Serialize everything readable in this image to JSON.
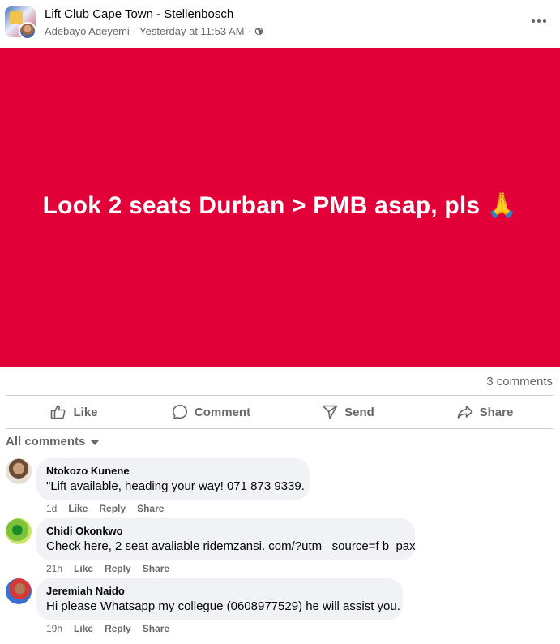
{
  "post": {
    "group_name": "Lift Club Cape Town - Stellenbosch",
    "author": "Adebayo Adeyemi",
    "separator": "·",
    "timestamp": "Yesterday at 11:53 AM",
    "privacy_icon": "globe-icon",
    "more_icon": "more-options-icon",
    "banner_text": "Look 2 seats Durban > PMB asap, pls 🙏",
    "banner_color": "#e10038",
    "comment_count": "3 comments"
  },
  "actions": {
    "like": "Like",
    "comment": "Comment",
    "send": "Send",
    "share": "Share"
  },
  "filter": {
    "label": "All comments"
  },
  "comments": [
    {
      "name": "Ntokozo Kunene",
      "text": "\"Lift available, heading your way! 071 873 9339.",
      "time": "1d",
      "like": "Like",
      "reply": "Reply",
      "share": "Share"
    },
    {
      "name": "Chidi Okonkwo",
      "text": "Check here, 2 seat avaliable ridemzansi. com/?utm _source=f b_pax",
      "time": "21h",
      "like": "Like",
      "reply": "Reply",
      "share": "Share"
    },
    {
      "name": "Jeremiah Naido",
      "text": "Hi please Whatsapp my collegue (0608977529) he will assist you.",
      "time": "19h",
      "like": "Like",
      "reply": "Reply",
      "share": "Share"
    }
  ],
  "colors": {
    "secondary_text": "#65676b",
    "bubble": "#f0f2f5"
  }
}
